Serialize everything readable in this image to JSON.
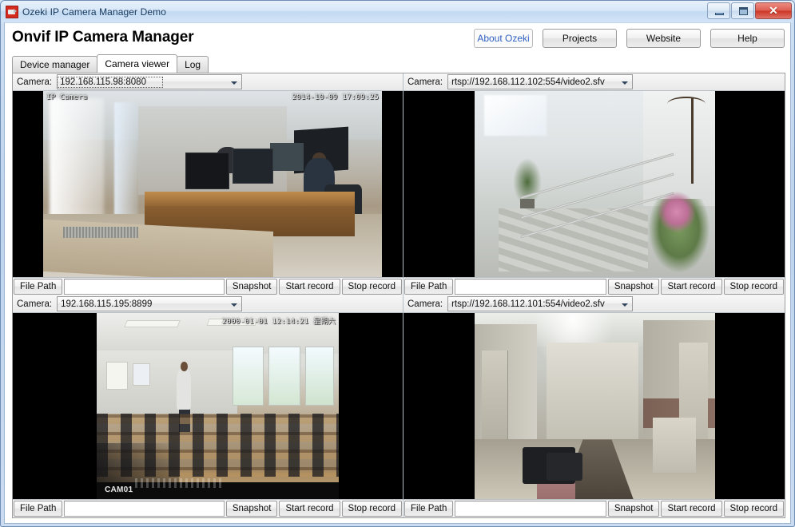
{
  "window": {
    "title": "Ozeki IP Camera Manager Demo",
    "icon": "camera-icon",
    "controls": {
      "minimize": "minimize-icon",
      "maximize": "maximize-icon",
      "close": "✕"
    }
  },
  "header": {
    "title": "Onvif IP Camera Manager",
    "buttons": [
      {
        "label": "About Ozeki",
        "style": "link"
      },
      {
        "label": "Projects",
        "style": "button"
      },
      {
        "label": "Website",
        "style": "button"
      },
      {
        "label": "Help",
        "style": "button"
      }
    ]
  },
  "tabs": [
    {
      "label": "Device manager",
      "active": false
    },
    {
      "label": "Camera viewer",
      "active": true
    },
    {
      "label": "Log",
      "active": false
    }
  ],
  "common": {
    "camera_label": "Camera:",
    "file_path_label": "File Path",
    "snapshot_label": "Snapshot",
    "start_record_label": "Start record",
    "stop_record_label": "Stop record",
    "file_path_value": ""
  },
  "colors": {
    "accent_link": "#2f5fbf",
    "title_text": "#16385c",
    "close_button": "#cc3525",
    "app_icon": "#d52b1e",
    "video_background": "#000000"
  },
  "panels": [
    {
      "id": "camera-panel-1",
      "camera_value": "192.168.115.98:8080",
      "focused": true,
      "scene": "office",
      "osd": {
        "top_left": "IP Camera",
        "top_right": "2014-10-09 17:09:25",
        "bottom_left": ""
      }
    },
    {
      "id": "camera-panel-2",
      "camera_value": "rtsp://192.168.112.102:554/video2.sfv",
      "focused": false,
      "scene": "stairwell",
      "osd": {
        "top_left": "",
        "top_right": "",
        "bottom_left": ""
      }
    },
    {
      "id": "camera-panel-3",
      "camera_value": "192.168.115.195:8899",
      "focused": false,
      "scene": "classroom",
      "osd": {
        "top_left": "",
        "top_right": "2000-01-01 12:14:21 星期六",
        "bottom_left": "CAM01"
      }
    },
    {
      "id": "camera-panel-4",
      "camera_value": "rtsp://192.168.112.101:554/video2.sfv",
      "focused": false,
      "scene": "corridor",
      "osd": {
        "top_left": "",
        "top_right": "",
        "bottom_left": ""
      }
    }
  ]
}
